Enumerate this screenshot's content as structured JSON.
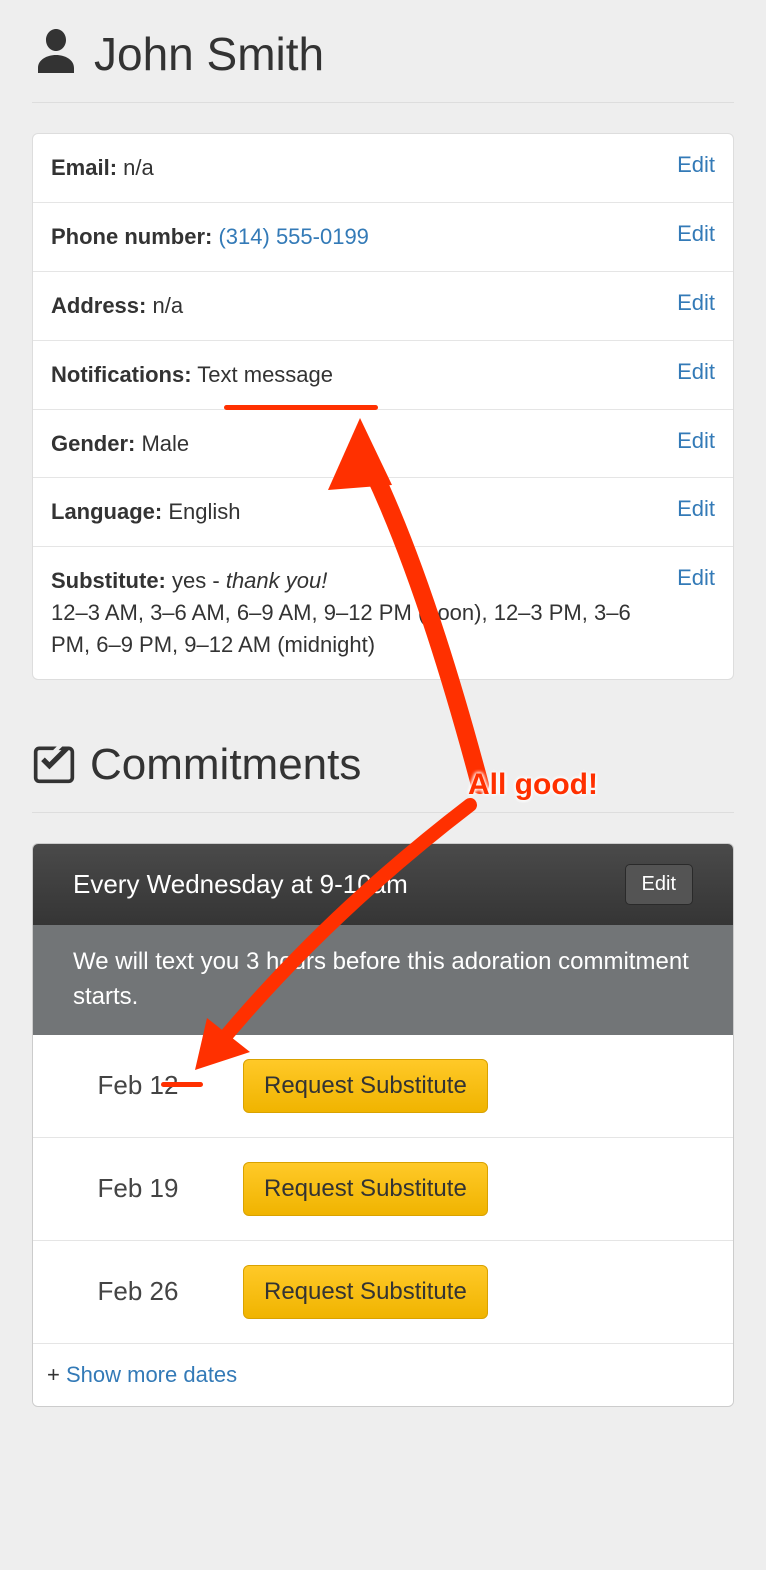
{
  "profile": {
    "name": "John Smith",
    "fields": {
      "email": {
        "label": "Email:",
        "value": "n/a",
        "edit": "Edit"
      },
      "phone": {
        "label": "Phone number:",
        "value": "(314) 555-0199",
        "edit": "Edit"
      },
      "address": {
        "label": "Address:",
        "value": "n/a",
        "edit": "Edit"
      },
      "notifications": {
        "label": "Notifications:",
        "value": "Text message",
        "edit": "Edit"
      },
      "gender": {
        "label": "Gender:",
        "value": "Male",
        "edit": "Edit"
      },
      "language": {
        "label": "Language:",
        "value": "English",
        "edit": "Edit"
      },
      "substitute": {
        "label": "Substitute:",
        "value": "yes",
        "dash": " - ",
        "thanks": "thank you!",
        "times": "12–3 AM, 3–6 AM, 6–9 AM, 9–12 PM (noon), 12–3 PM, 3–6 PM, 6–9 PM, 9–12 AM (midnight)",
        "edit": "Edit"
      }
    }
  },
  "commitments": {
    "heading": "Commitments",
    "schedule": {
      "title": "Every Wednesday at 9-10am",
      "edit": "Edit",
      "notice": "We will text you 3 hours before this adoration commitment starts.",
      "dates": [
        {
          "label": "Feb 12",
          "button": "Request Substitute"
        },
        {
          "label": "Feb 19",
          "button": "Request Substitute"
        },
        {
          "label": "Feb 26",
          "button": "Request Substitute"
        }
      ],
      "more_plus": "+ ",
      "more": "Show more dates"
    }
  },
  "annotation": {
    "text": "All good!"
  }
}
